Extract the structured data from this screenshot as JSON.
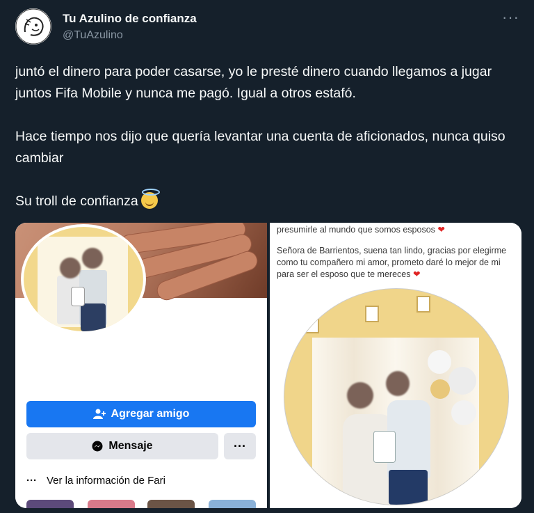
{
  "author": {
    "name": "Tu Azulino de confianza",
    "handle": "@TuAzulino"
  },
  "menu_glyph": "···",
  "tweet": {
    "p1": "juntó el dinero para poder casarse, yo le presté dinero cuando llegamos a jugar juntos Fifa Mobile y nunca me pagó. Igual a otros estafó.",
    "p2": "Hace tiempo nos dijo que quería levantar una cuenta de aficionados, nunca quiso cambiar",
    "p3": "Su troll de confianza"
  },
  "fb_profile": {
    "add_friend": "Agregar amigo",
    "message": "Mensaje",
    "more": "···",
    "info": "Ver la información de Fari",
    "info_dots": "···"
  },
  "caption": {
    "line1": "presumirle al mundo que somos esposos",
    "line2": "Señora de Barrientos, suena tan lindo, gracias por elegirme como tu compañero mi amor, prometo daré lo mejor de mi para ser el esposo que te mereces"
  },
  "colors": {
    "bg": "#15202b",
    "fb_blue": "#1877f2",
    "muted": "#8b98a5"
  },
  "icons": [
    "person-add-icon",
    "messenger-icon",
    "more-dots-icon",
    "smiling-face-with-halo-icon",
    "heart-icon"
  ]
}
